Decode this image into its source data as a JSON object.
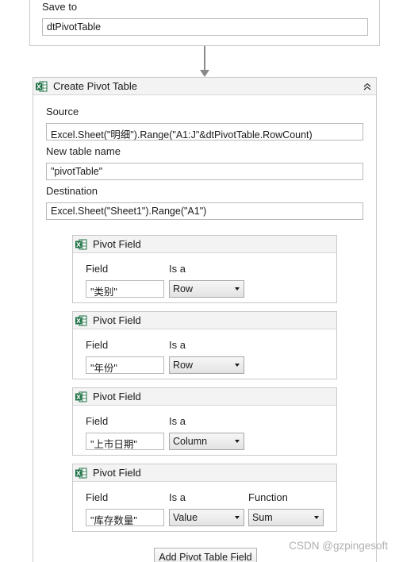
{
  "save_card": {
    "label": "Save to",
    "value": "dtPivotTable"
  },
  "activity": {
    "title": "Create Pivot Table",
    "icon": "excel-icon",
    "collapse_icon": "double-chevron-up-icon",
    "source_label": "Source",
    "source_value": "Excel.Sheet(\"明细\").Range(\"A1:J\"&dtPivotTable.RowCount)",
    "new_table_name_label": "New table name",
    "new_table_name_value": "\"pivotTable\"",
    "destination_label": "Destination",
    "destination_value": "Excel.Sheet(\"Sheet1\").Range(\"A1\")"
  },
  "pivot_fields": [
    {
      "title": "Pivot Field",
      "field_label": "Field",
      "field_value": "\"类别\"",
      "isa_label": "Is a",
      "isa_value": "Row"
    },
    {
      "title": "Pivot Field",
      "field_label": "Field",
      "field_value": "\"年份\"",
      "isa_label": "Is a",
      "isa_value": "Row"
    },
    {
      "title": "Pivot Field",
      "field_label": "Field",
      "field_value": "\"上市日期\"",
      "isa_label": "Is a",
      "isa_value": "Column"
    },
    {
      "title": "Pivot Field",
      "field_label": "Field",
      "field_value": "\"库存数量\"",
      "isa_label": "Is a",
      "isa_value": "Value",
      "function_label": "Function",
      "function_value": "Sum"
    }
  ],
  "add_button_label": "Add Pivot Table Field",
  "watermark": "CSDN @gzpingesoft",
  "colors": {
    "excel_green": "#1e7145",
    "header_bg": "#f3f3f3",
    "border": "#c9c9c9",
    "connector": "#8a8a8a"
  }
}
